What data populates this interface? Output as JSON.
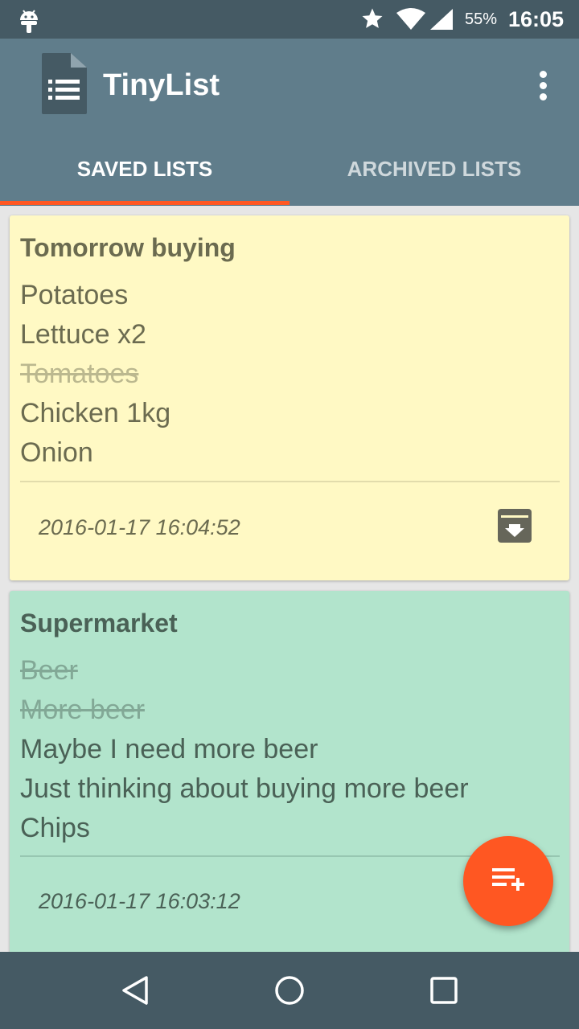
{
  "status_bar": {
    "battery": "55%",
    "time": "16:05",
    "icons": [
      "android-icon",
      "star-icon",
      "wifi-icon",
      "signal-icon"
    ]
  },
  "app_bar": {
    "title": "TinyList",
    "logo_icon": "list-document-icon",
    "menu_icon": "more-vert-icon"
  },
  "tabs": [
    {
      "label": "SAVED LISTS",
      "selected": true
    },
    {
      "label": "ARCHIVED LISTS",
      "selected": false
    }
  ],
  "lists": [
    {
      "title": "Tomorrow buying",
      "color": "#fff9c4",
      "items": [
        {
          "text": "Potatoes",
          "done": false
        },
        {
          "text": "Lettuce x2",
          "done": false
        },
        {
          "text": "Tomatoes",
          "done": true
        },
        {
          "text": "Chicken 1kg",
          "done": false
        },
        {
          "text": "Onion",
          "done": false
        }
      ],
      "date": "2016-01-17 16:04:52",
      "action_icon": "archive-icon"
    },
    {
      "title": "Supermarket",
      "color": "#b2e4cc",
      "items": [
        {
          "text": "Beer",
          "done": true
        },
        {
          "text": "More beer",
          "done": true
        },
        {
          "text": "Maybe I need more beer",
          "done": false
        },
        {
          "text": "Just thinking about buying more beer",
          "done": false
        },
        {
          "text": "Chips",
          "done": false
        }
      ],
      "date": "2016-01-17 16:03:12"
    }
  ],
  "fab": {
    "icon": "playlist-add-icon",
    "color": "#ff5722"
  },
  "nav_bar": {
    "icons": [
      "back-icon",
      "home-icon",
      "recents-icon"
    ]
  },
  "colors": {
    "status_bar": "#455a64",
    "app_bar": "#607d8b",
    "accent": "#ff5722"
  }
}
